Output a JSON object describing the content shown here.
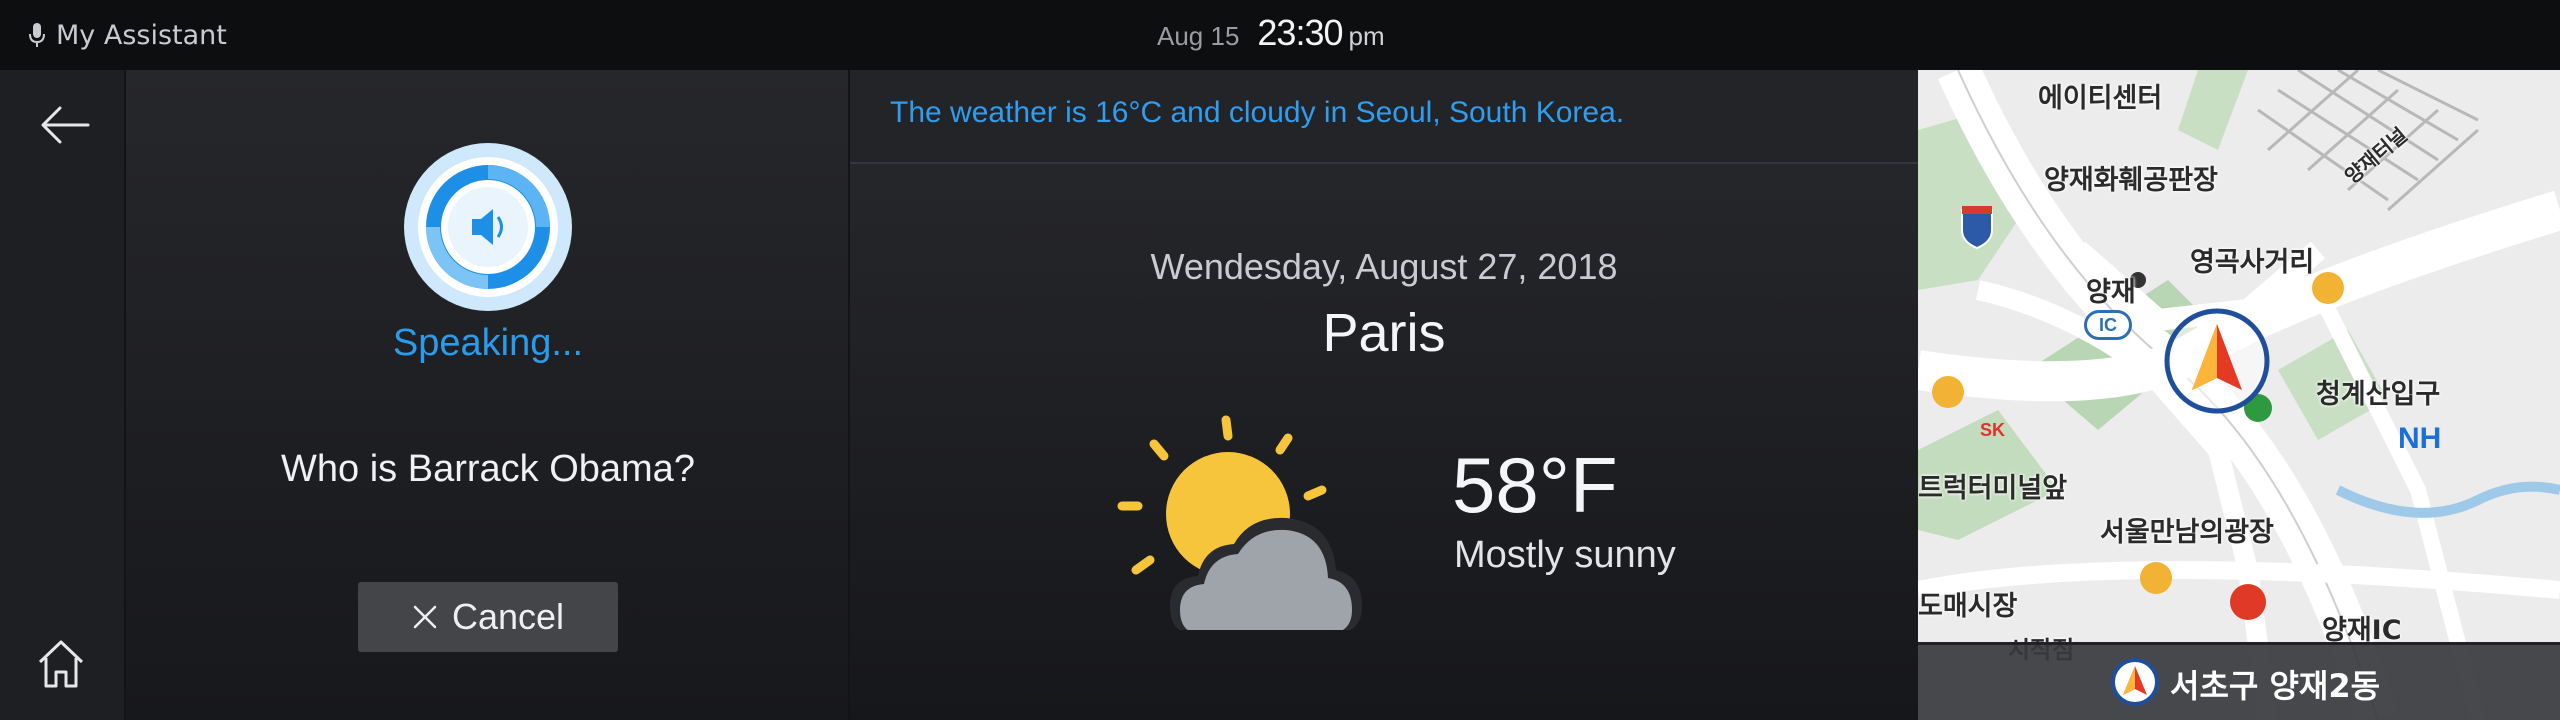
{
  "topbar": {
    "assistant_label": "My Assistant",
    "date": "Aug 15",
    "time": "23:30",
    "ampm": "pm",
    "icons": {
      "mic": "microphone-icon"
    }
  },
  "nav": {
    "icons": {
      "back": "back-arrow-icon",
      "home": "home-icon"
    }
  },
  "voice": {
    "status": "Speaking...",
    "query": "Who is Barrack Obama?",
    "cancel_label": "Cancel",
    "accent": "#2a9cec",
    "icons": {
      "orb": "speaker-icon",
      "cancel": "close-icon"
    }
  },
  "weather": {
    "message": "The weather is 16°C and cloudy in Seoul, South Korea.",
    "date": "Wendesday, August 27, 2018",
    "city": "Paris",
    "temperature": "58°F",
    "condition": "Mostly sunny",
    "icon": "partly-cloudy-icon",
    "accent": "#2f9df0"
  },
  "map": {
    "labels": {
      "l1": "에이티센터",
      "l2": "양재화훼공판장",
      "l3": "영곡사거리",
      "l4": "양재",
      "l5": "청계산입구",
      "l6": "트럭터미널앞",
      "l7": "서울만남의광장",
      "l8": "도매시장",
      "l9": "양재IC",
      "l10": "양재터널",
      "l11": "시작점",
      "ic": "IC",
      "nh": "NH",
      "sk": "SK"
    },
    "location": "서초구 양재2동",
    "icons": {
      "arrow": "navigation-arrow-icon",
      "footer": "location-arrow-icon"
    }
  }
}
